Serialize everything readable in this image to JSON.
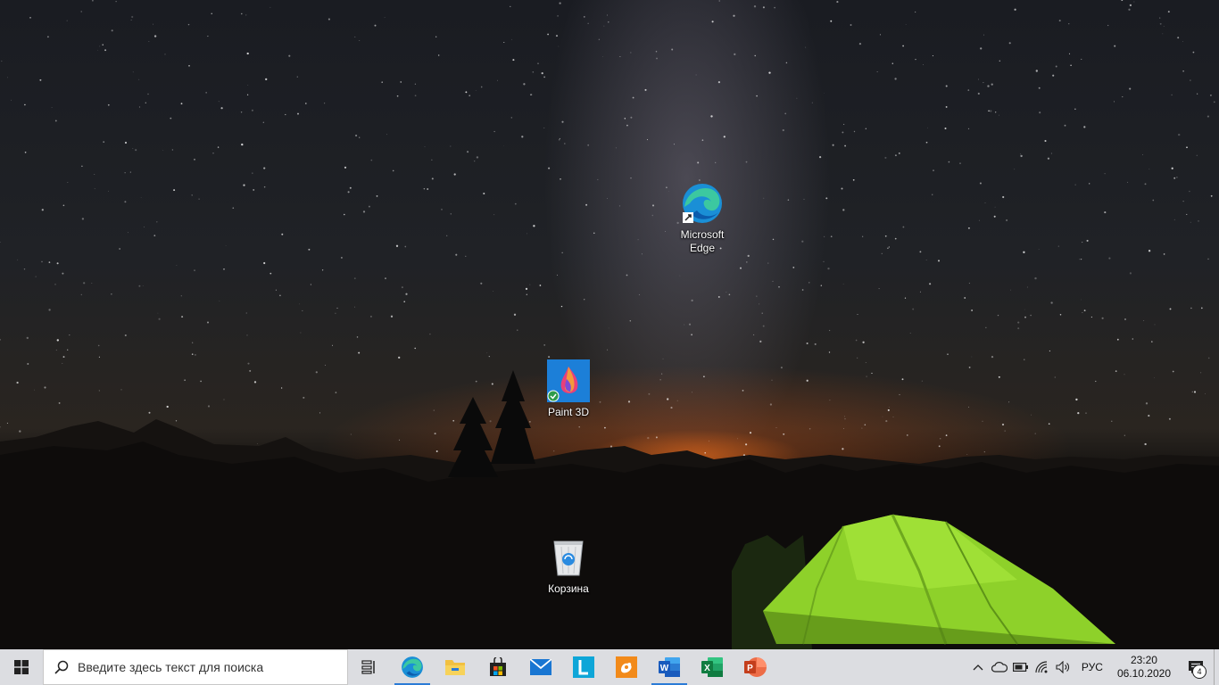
{
  "desktop": {
    "icons": {
      "edge": {
        "label_line1": "Microsoft",
        "label_line2": "Edge"
      },
      "paint3d": {
        "label": "Paint 3D"
      },
      "recycle_bin": {
        "label": "Корзина"
      }
    }
  },
  "taskbar": {
    "search_placeholder": "Введите здесь текст для поиска",
    "pinned": [
      {
        "name": "task-view-icon"
      },
      {
        "name": "edge-icon",
        "active": true
      },
      {
        "name": "file-explorer-icon"
      },
      {
        "name": "store-icon"
      },
      {
        "name": "mail-icon"
      },
      {
        "name": "l-app-icon"
      },
      {
        "name": "hand-app-icon"
      },
      {
        "name": "word-icon",
        "active": true
      },
      {
        "name": "excel-icon"
      },
      {
        "name": "powerpoint-icon"
      }
    ],
    "tray": {
      "language": "РУС",
      "time": "23:20",
      "date": "06.10.2020",
      "notification_count": "4"
    }
  },
  "colors": {
    "taskbar_bg": "#dcdde1",
    "accent": "#2b7bd6",
    "tent_green": "#8ed12a"
  }
}
